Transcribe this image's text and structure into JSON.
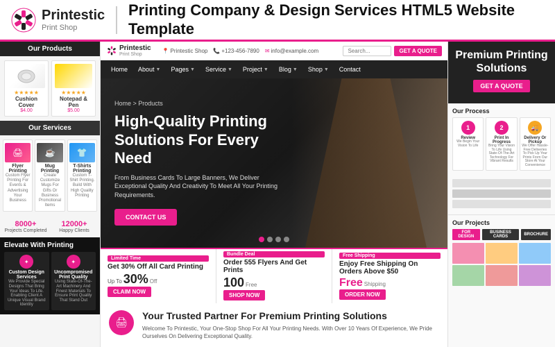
{
  "topHeader": {
    "logoName": "Printestic",
    "logoSub": "Print Shop",
    "title": "Printing Company & Design Services  HTML5 Website Template"
  },
  "siteTopbar": {
    "logoName": "Printestic",
    "logoSub": "Print Shop",
    "locationLabel": "Printestic Shop",
    "phone": "+123-456-7890",
    "email": "info@example.com",
    "searchPlaceholder": "Search...",
    "quoteBtn": "GET A QUOTE"
  },
  "siteNav": {
    "items": [
      {
        "label": "Home"
      },
      {
        "label": "About",
        "hasArrow": true
      },
      {
        "label": "Pages",
        "hasArrow": true
      },
      {
        "label": "Service",
        "hasArrow": true
      },
      {
        "label": "Project",
        "hasArrow": true
      },
      {
        "label": "Blog",
        "hasArrow": true
      },
      {
        "label": "Shop",
        "hasArrow": true
      },
      {
        "label": "Contact"
      }
    ]
  },
  "hero": {
    "breadcrumb": "Home > Products",
    "title": "High-Quality Printing Solutions For Every Need",
    "subtitle": "From Business Cards To Large Banners, We Deliver Exceptional Quality And Creativity To Meet All Your Printing Requirements.",
    "ctaButton": "CONTACT US",
    "dots": [
      true,
      false,
      false,
      false
    ]
  },
  "products": {
    "sectionTitle": "Our Products",
    "items": [
      {
        "name": "Cushion Cover",
        "price": "$4.00"
      },
      {
        "name": "Notepad & Pen",
        "price": "$5.00"
      }
    ]
  },
  "services": {
    "sectionTitle": "Our Services",
    "items": [
      {
        "icon": "🖨",
        "name": "Flyer Printing",
        "desc": "Custom Flyer Printing For Events & Advertising Your Business"
      },
      {
        "icon": "☕",
        "name": "Mug Printing",
        "desc": "Create Customize Mugs For Gifts Or Business Promotional Items"
      },
      {
        "icon": "👕",
        "name": "T-Shirts Printing",
        "desc": "Custom T-Shirt Printing. Build With High Quality Printing"
      }
    ]
  },
  "stats": [
    {
      "number": "8000+",
      "label": "Projects Completed"
    },
    {
      "number": "12000+",
      "label": "Happy Clients"
    }
  ],
  "elevate": {
    "title": "Elevate With Printing",
    "items": [
      {
        "icon": "✦",
        "name": "Custom Design Services",
        "desc": "We Provide Special Designs That Bring Your Ideas To Life. Enabling Client A Unique Visual Brand Identity"
      },
      {
        "icon": "✦",
        "name": "Uncompromised Print Quality",
        "desc": "Using State-Of-The-Art Machinery And Finest Materials To Ensure Print Quality That Stand Out"
      }
    ]
  },
  "deals": [
    {
      "badge": "Limited Time",
      "title": "Get 30% Off All Card Printing",
      "value": "Up To",
      "big": "30%",
      "valueSuffix": "Off",
      "btn": "CLAIM NOW"
    },
    {
      "badge": "Bundle Deal",
      "title": "Order 555 Flyers And Get Prints",
      "big": "100",
      "valueSuffix": "Free",
      "btn": "SHOP NOW"
    },
    {
      "badge": "Free Shipping",
      "title": "Enjoy Free Shipping On Orders Above $50",
      "big": "Free",
      "valueSuffix": "Shipping",
      "btn": "ORDER NOW"
    }
  ],
  "about": {
    "title": "Your Trusted Partner For Premium Printing Solutions",
    "desc": "Welcome To Printestic, Your One-Stop Shop For All Your Printing Needs. With Over 10 Years Of Experience, We Pride Ourselves On Delivering Exceptional Quality."
  },
  "rightSidebar": {
    "premium": {
      "title": "Premium Printing Solutions",
      "btn": "GET A QUOTE"
    },
    "processTitle": "Our Process",
    "steps": [
      {
        "num": "1",
        "name": "Review",
        "desc": "We Begin Your Vision To Life"
      },
      {
        "num": "2",
        "name": "Print In Progress",
        "desc": "Bring Your Vision To Life Using State-Of-The-Art Technology For Vibrant Results"
      },
      {
        "num": "3",
        "icon": "🚚",
        "name": "Delivery Or Pickup",
        "desc": "We Offer Hassle-Free Deliveries To Pick Up Your Prints From Our Store At Your Convenience"
      }
    ],
    "projectsTitle": "Our Projects",
    "projectBtns": [
      "FOR DESIGN",
      "BUSINESS CARDS",
      "BROCHURE"
    ]
  }
}
